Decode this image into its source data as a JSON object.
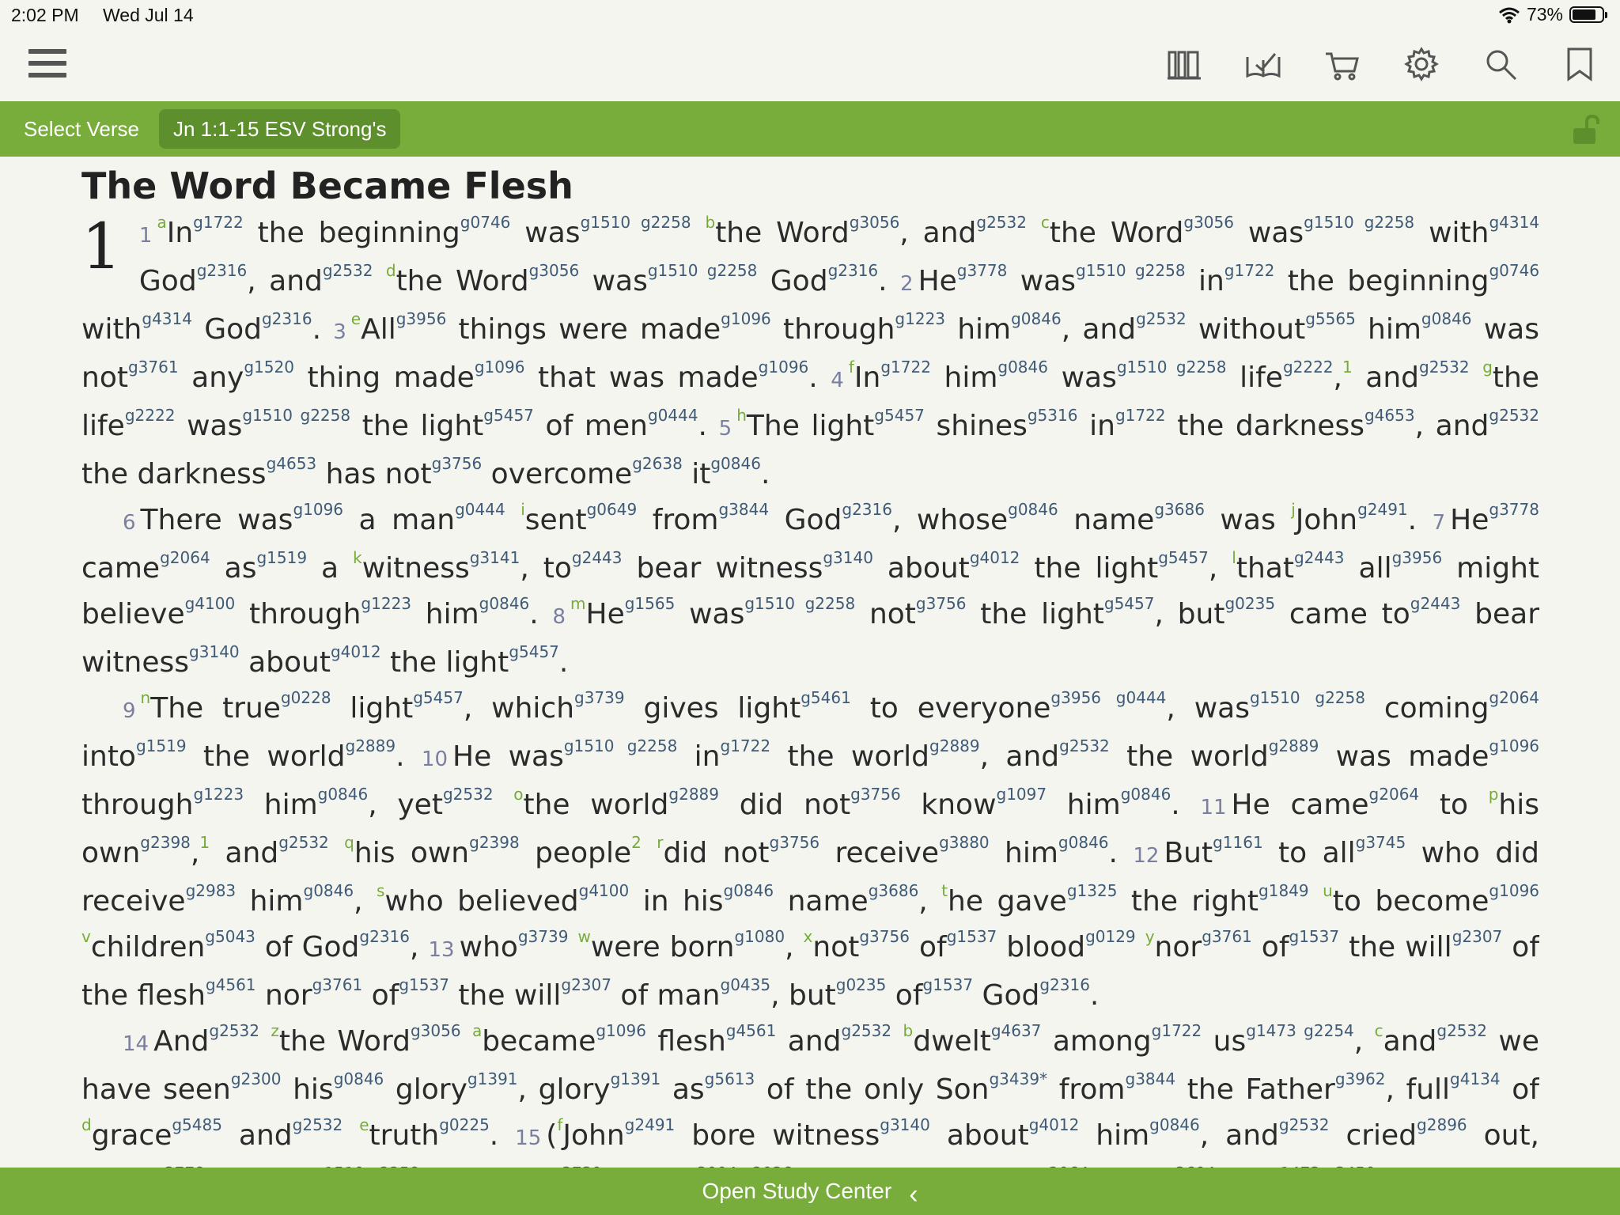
{
  "status": {
    "time": "2:02 PM",
    "date": "Wed Jul 14",
    "battery": "73%"
  },
  "toolbar": {
    "icons": [
      "library-icon",
      "reading-plans-icon",
      "cart-icon",
      "settings-gear-icon",
      "search-icon",
      "bookmark-icon"
    ]
  },
  "nav": {
    "select_verse": "Select Verse",
    "reference": "Jn 1:1-15 ESV Strong's"
  },
  "passage": {
    "heading": "The Word Became Flesh",
    "chapter": "1"
  },
  "bottom": {
    "label": "Open Study Center"
  },
  "colors": {
    "accent_green": "#78ad3b",
    "pill_green": "#5d8f2c",
    "strongs_blue": "#3f5a76",
    "footnote_green": "#76ab3a"
  }
}
